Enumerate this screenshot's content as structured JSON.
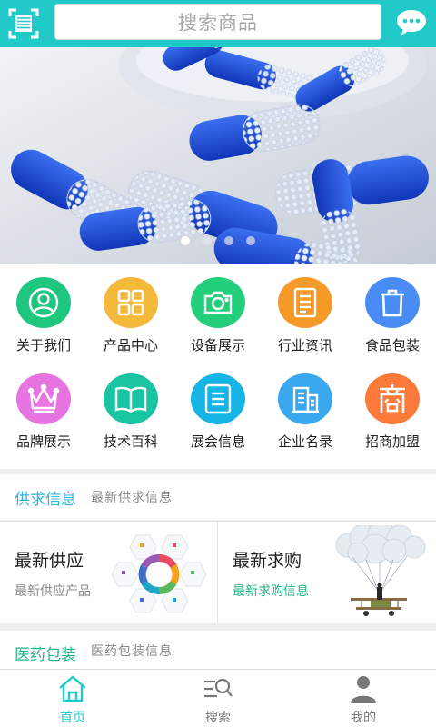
{
  "header": {
    "search_placeholder": "搜索商品",
    "scan_icon": "scan-icon",
    "message_icon": "chat-bubble-icon",
    "color": "#21c9c9"
  },
  "banner": {
    "image": "blue-white-capsules-photo",
    "slides_total": 4,
    "active_slide": 1
  },
  "grid": {
    "items": [
      {
        "label": "关于我们",
        "icon": "user-icon",
        "color": "#1ec680"
      },
      {
        "label": "产品中心",
        "icon": "grid-icon",
        "color": "#f4b93a"
      },
      {
        "label": "设备展示",
        "icon": "camera-icon",
        "color": "#23cf7a"
      },
      {
        "label": "行业资讯",
        "icon": "document-icon",
        "color": "#f59a28"
      },
      {
        "label": "食品包装",
        "icon": "trash-icon",
        "color": "#4a8cf5"
      },
      {
        "label": "品牌展示",
        "icon": "crown-icon",
        "color": "#e874e1"
      },
      {
        "label": "技术百科",
        "icon": "book-icon",
        "color": "#19c4a3"
      },
      {
        "label": "展会信息",
        "icon": "list-icon",
        "color": "#16b5e6"
      },
      {
        "label": "企业名录",
        "icon": "building-icon",
        "color": "#3aa7ef"
      },
      {
        "label": "招商加盟",
        "icon": "shang-icon",
        "color": "#fb7a3a"
      }
    ]
  },
  "supply_section": {
    "title": "供求信息",
    "subtitle": "最新供求信息",
    "title_color": "#2eb4e0"
  },
  "cards": {
    "supply": {
      "title": "最新供应",
      "subtitle": "最新供应产品",
      "image": "hexagon-infographic"
    },
    "demand": {
      "title": "最新求购",
      "subtitle": "最新求购信息",
      "subtitle_color": "#22b58a",
      "image": "biplane-balloon-illustration"
    }
  },
  "pharma_section": {
    "title": "医药包装",
    "subtitle": "医药包装信息",
    "title_color": "#22b58a"
  },
  "bottom_nav": {
    "items": [
      {
        "label": "首页",
        "icon": "home-icon",
        "active": true
      },
      {
        "label": "搜索",
        "icon": "search-list-icon",
        "active": false
      },
      {
        "label": "我的",
        "icon": "user-profile-icon",
        "active": false
      }
    ],
    "active_color": "#21c9c9"
  }
}
